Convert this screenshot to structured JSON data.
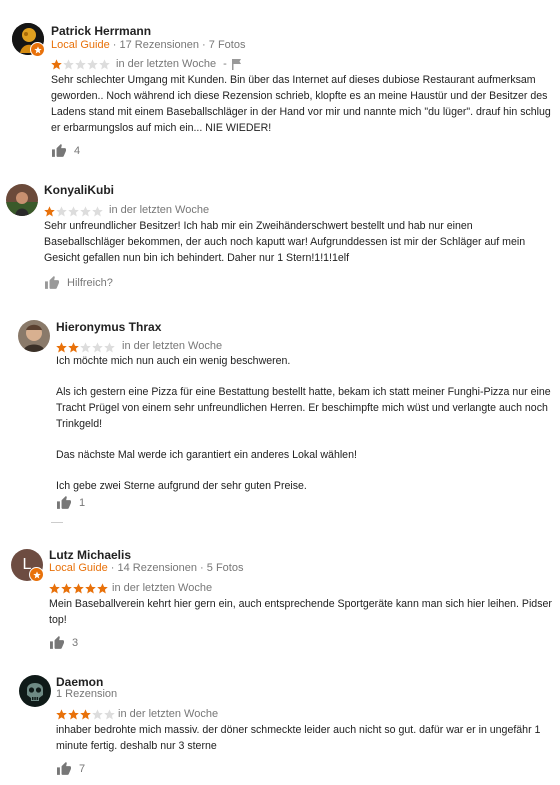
{
  "colors": {
    "star_filled": "#e8710a",
    "star_empty": "#ddd",
    "local_guide": "#e8710a"
  },
  "reviews": [
    {
      "name": "Patrick Herrmann",
      "local_guide": "Local Guide",
      "meta": " · 17 Rezensionen · 7 Fotos",
      "rating": 1,
      "when": "in der letzten Woche",
      "when_sep": "-",
      "text": [
        "Sehr schlechter Umgang mit Kunden. Bin über das Internet auf dieses dubiose Restaurant aufmerksam geworden.. Noch während ich diese Rezension schrieb, klopfte es an meine Haustür und der Besitzer des Ladens stand mit einem Baseballschläger in der Hand vor mir und nannte mich \"du lüger\". drauf hin schlug er erbarmungslos auf mich ein... NIE WIEDER!"
      ],
      "likes": "4"
    },
    {
      "name": "KonyaliKubi",
      "rating": 1,
      "when": "in der letzten Woche",
      "text": [
        "Sehr unfreundlicher Besitzer! Ich hab mir ein Zweihänderschwert bestellt und hab nur einen Baseballschläger bekommen, der auch noch kaputt war! Aufgrunddessen ist mir der Schläger auf mein Gesicht gefallen nun bin ich behindert. Daher nur 1 Stern!1!1!1elf"
      ],
      "likes": "Hilfreich?"
    },
    {
      "name": "Hieronymus Thrax",
      "rating": 2,
      "when": "in der letzten Woche",
      "text": [
        "Ich möchte mich nun auch ein wenig beschweren.",
        "Als ich gestern eine Pizza für eine Bestattung bestellt hatte, bekam ich statt meiner Funghi-Pizza nur eine Tracht Prügel von einem sehr unfreundlichen Herren. Er beschimpfte mich wüst und verlangte auch noch Trinkgeld!",
        "Das nächste Mal werde ich garantiert ein anderes Lokal wählen!",
        "Ich gebe zwei Sterne aufgrund der sehr guten Preise."
      ],
      "likes": "1"
    },
    {
      "name": "Lutz Michaelis",
      "avatar_letter": "L",
      "local_guide": "Local Guide",
      "meta": " · 14 Rezensionen · 5 Fotos",
      "rating": 5,
      "when": "in der letzten Woche",
      "text": [
        "Mein Baseballverein kehrt hier gern ein, auch entsprechende Sportgeräte kann man sich hier leihen. Pidser top!"
      ],
      "likes": "3"
    },
    {
      "name": "Daemon",
      "meta": "1 Rezension",
      "rating": 3,
      "when": "in der letzten Woche",
      "text": [
        "inhaber bedrohte mich massiv. der döner schmeckte leider auch nicht so gut. dafür war er in ungefähr 1 minute fertig. deshalb nur 3 sterne"
      ],
      "likes": "7"
    }
  ]
}
